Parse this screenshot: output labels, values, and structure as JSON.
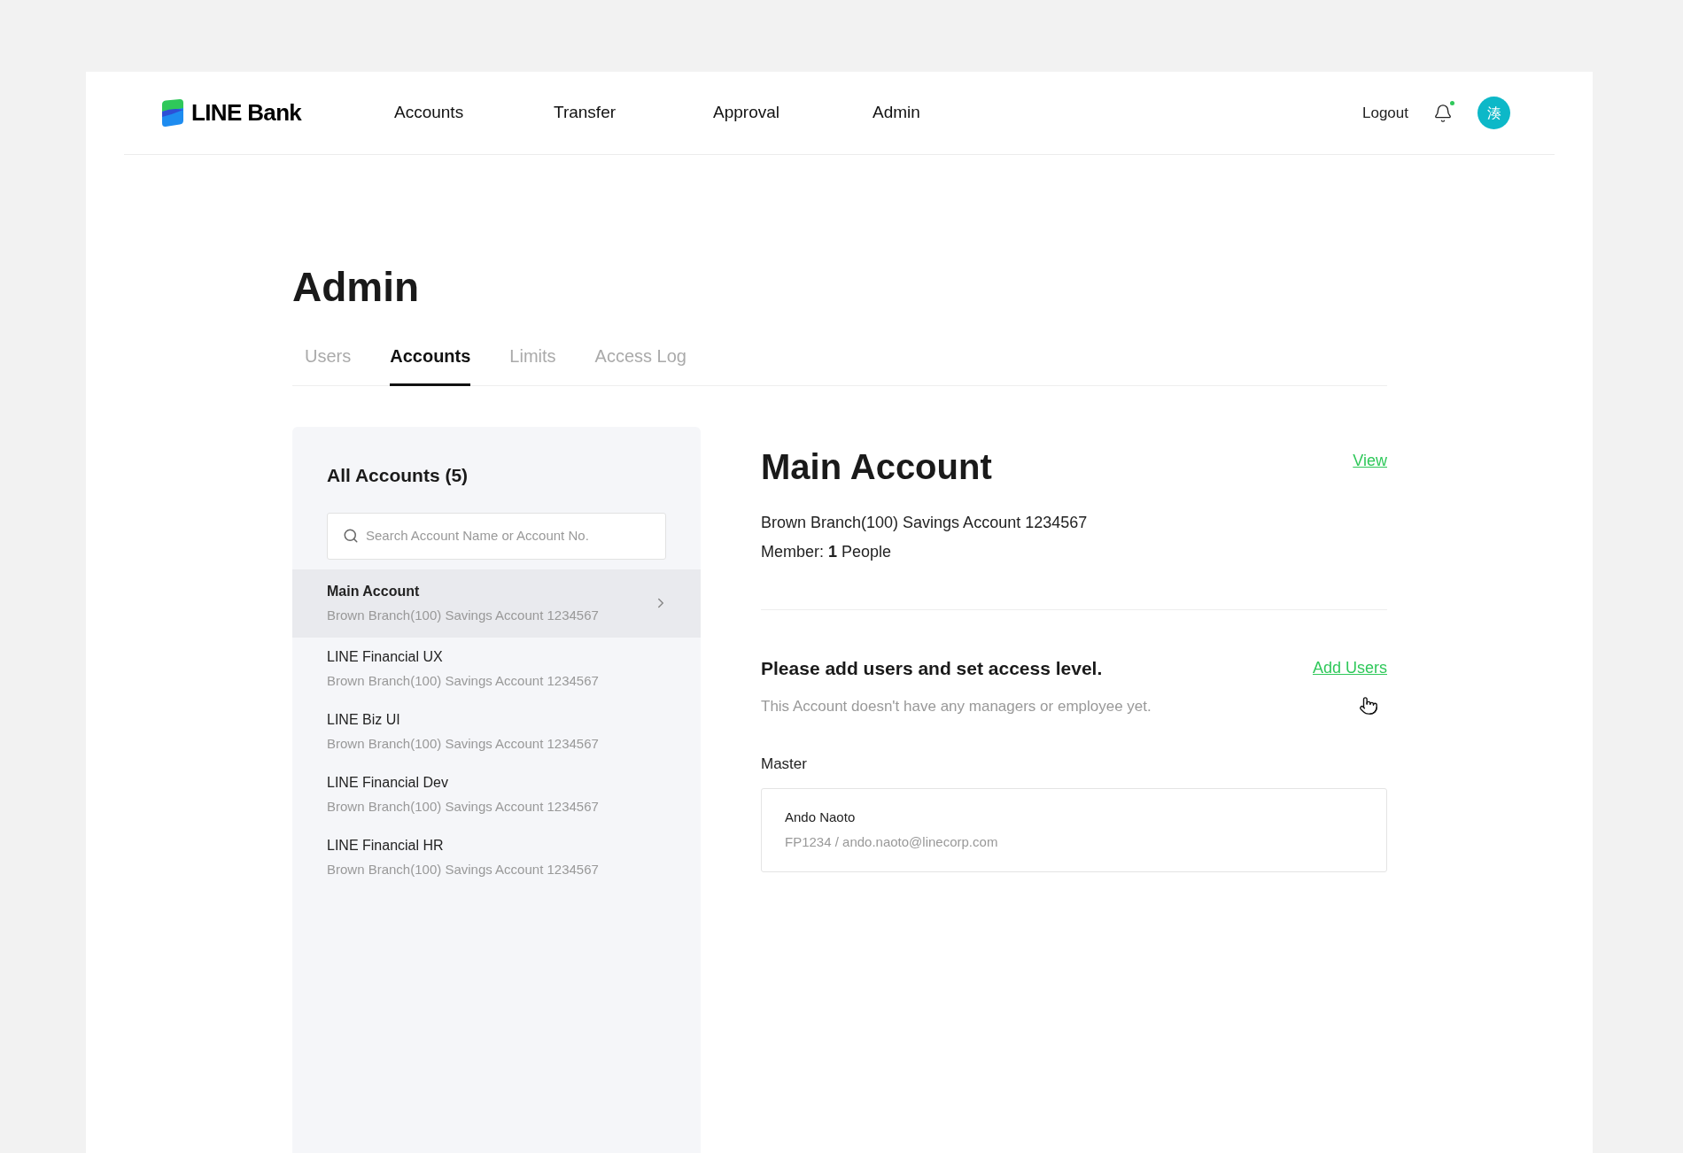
{
  "header": {
    "logo": "LINE Bank",
    "nav": [
      {
        "label": "Accounts",
        "selected": false
      },
      {
        "label": "Transfer",
        "selected": false
      },
      {
        "label": "Approval",
        "selected": false
      },
      {
        "label": "Admin",
        "selected": false
      }
    ],
    "logout": "Logout",
    "notification_dot": true,
    "avatar": "湊"
  },
  "page_title": "Admin",
  "tabs": [
    {
      "label": "Users",
      "selected": false
    },
    {
      "label": "Accounts",
      "selected": true
    },
    {
      "label": "Limits",
      "selected": false
    },
    {
      "label": "Access Log",
      "selected": false
    }
  ],
  "sidebar": {
    "title": "All Accounts (5)",
    "search": {
      "placeholder": "Search Account Name or Account No."
    },
    "items": [
      {
        "name": "Main Account",
        "detail": "Brown Branch(100) Savings Account 1234567",
        "selected": true
      },
      {
        "name": "LINE Financial UX",
        "detail": "Brown Branch(100) Savings Account 1234567",
        "selected": false
      },
      {
        "name": "LINE Biz UI",
        "detail": "Brown Branch(100) Savings Account 1234567",
        "selected": false
      },
      {
        "name": "LINE Financial Dev",
        "detail": "Brown Branch(100) Savings Account 1234567",
        "selected": false
      },
      {
        "name": "LINE Financial HR",
        "detail": "Brown Branch(100) Savings Account 1234567",
        "selected": false
      }
    ]
  },
  "detail": {
    "title": "Main Account",
    "view_link": "View",
    "account_line": "Brown Branch(100) Savings Account 1234567",
    "member_line": "Member: **1** People",
    "prompt_title": "Please add users and set access level.",
    "add_users_link": "Add Users",
    "empty_note": "This Account doesn't have any managers or employee yet.",
    "master_label": "Master",
    "master": {
      "name": "Ando Naoto",
      "info": "FP1234 / ando.naoto@linecorp.com"
    }
  }
}
